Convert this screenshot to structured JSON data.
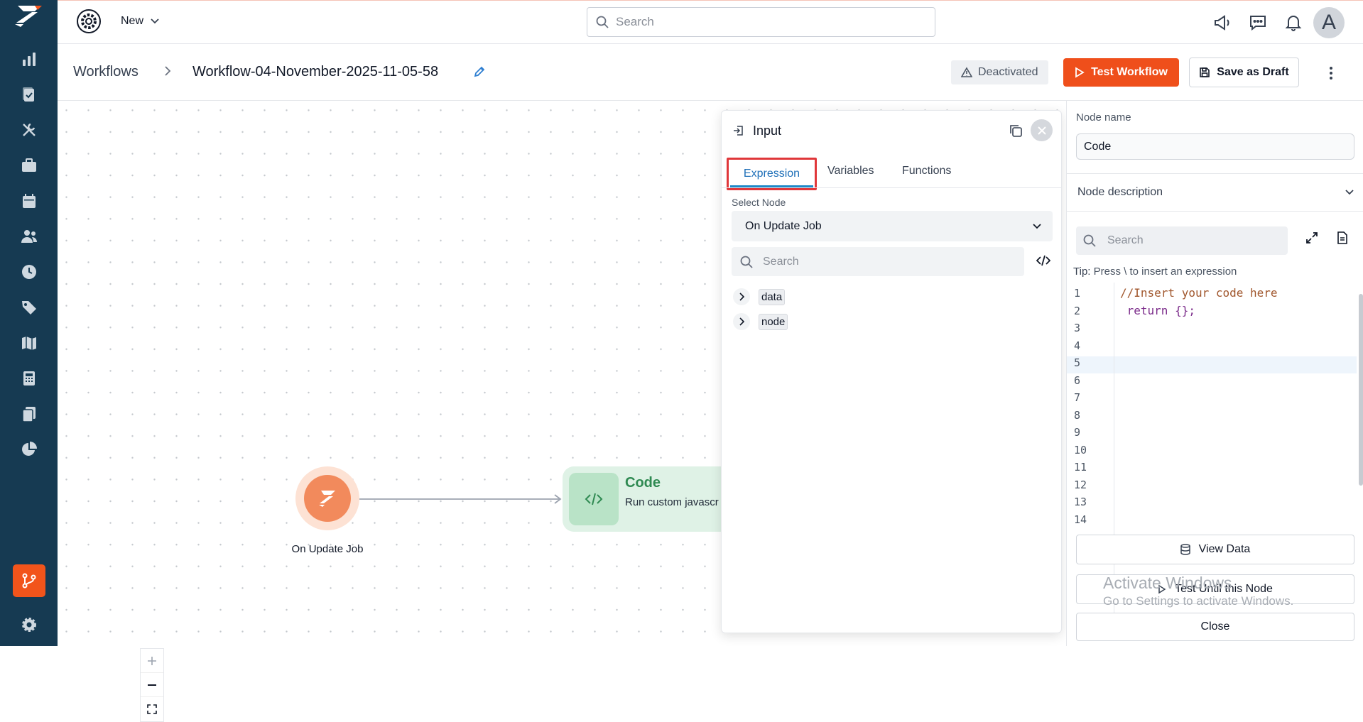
{
  "sidebar": {
    "items": [
      {
        "icon": "bar-chart-icon",
        "active": false
      },
      {
        "icon": "clipboard-check-icon",
        "active": false
      },
      {
        "icon": "tools-icon",
        "active": false
      },
      {
        "icon": "briefcase-icon",
        "active": false
      },
      {
        "icon": "calendar-icon",
        "active": false
      },
      {
        "icon": "users-icon",
        "active": false
      },
      {
        "icon": "clock-icon",
        "active": false
      },
      {
        "icon": "tag-icon",
        "active": false
      },
      {
        "icon": "map-icon",
        "active": false
      },
      {
        "icon": "calculator-icon",
        "active": false
      },
      {
        "icon": "documents-icon",
        "active": false
      },
      {
        "icon": "pie-chart-icon",
        "active": false
      },
      {
        "icon": "workflow-icon",
        "active": true
      },
      {
        "icon": "settings-icon",
        "active": false
      }
    ]
  },
  "topbar": {
    "new_label": "New",
    "search_placeholder": "Search",
    "avatar_letter": "A"
  },
  "breadcrumb": {
    "root": "Workflows",
    "title": "Workflow-04-November-2025-11-05-58"
  },
  "actions": {
    "status": "Deactivated",
    "test_label": "Test Workflow",
    "draft_label": "Save as Draft"
  },
  "canvas": {
    "trigger_label": "On Update Job",
    "code_node_title": "Code",
    "code_node_desc": "Run custom javascr"
  },
  "input_panel": {
    "title": "Input",
    "tabs": [
      "Expression",
      "Variables",
      "Functions"
    ],
    "active_tab": "Expression",
    "select_label": "Select Node",
    "select_value": "On Update Job",
    "search_placeholder": "Search",
    "tree": [
      "data",
      "node"
    ]
  },
  "node_panel": {
    "name_label": "Node name",
    "name_value": "Code",
    "description_label": "Node description",
    "search_placeholder": "Search",
    "tip_prefix": "Tip:",
    "tip_text": " Press \\ to insert an expression",
    "code_lines": [
      "//Insert your code here",
      " return {};",
      "",
      "",
      "",
      "",
      "",
      "",
      "",
      "",
      "",
      "",
      "",
      ""
    ],
    "line_numbers": [
      "1",
      "2",
      "3",
      "4",
      "5",
      "6",
      "7",
      "8",
      "9",
      "10",
      "11",
      "12",
      "13",
      "14"
    ],
    "view_data_label": "View Data",
    "test_node_label": "Test Until this Node",
    "close_label": "Close"
  },
  "watermark": {
    "line1": "Activate Windows",
    "line2": "Go to Settings to activate Windows."
  },
  "colors": {
    "sidebar_bg": "#163a52",
    "accent": "#ef4f1b",
    "code_green": "#2f8a52"
  }
}
